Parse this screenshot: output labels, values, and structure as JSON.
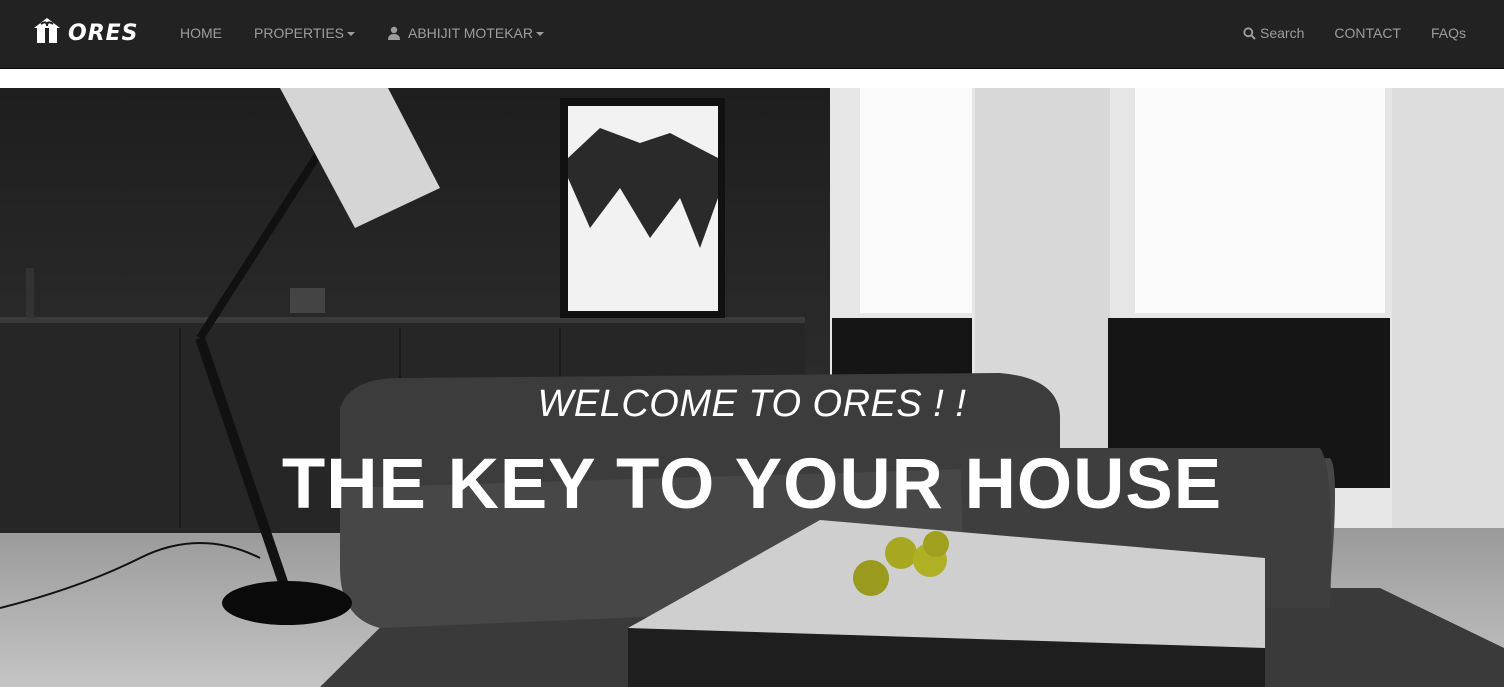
{
  "brand": {
    "name": "ORES",
    "logo_icon": "house-gift-icon"
  },
  "nav_left": [
    {
      "label": "HOME",
      "dropdown": false
    },
    {
      "label": "PROPERTIES",
      "dropdown": true
    },
    {
      "label": "ABHIJIT MOTEKAR",
      "dropdown": true,
      "icon": "user-icon"
    }
  ],
  "nav_right": [
    {
      "label": "Search",
      "icon": "search-icon"
    },
    {
      "label": "CONTACT"
    },
    {
      "label": "FAQs"
    }
  ],
  "hero": {
    "subtitle": "WELCOME TO ORES ! !",
    "title": "THE KEY TO YOUR HOUSE"
  },
  "colors": {
    "navbar": "#222222",
    "nav_text": "#9d9d9d",
    "hero_text": "#ffffff"
  }
}
